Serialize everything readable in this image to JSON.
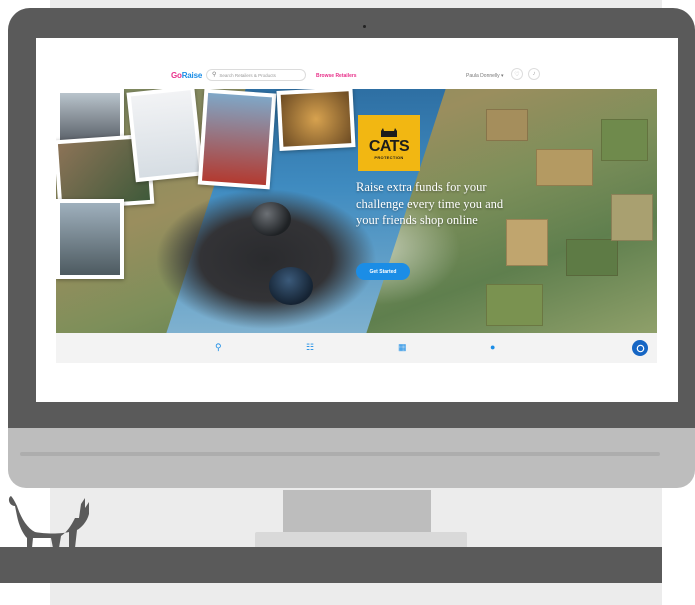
{
  "navbar": {
    "logo_part1": "Go",
    "logo_part2": "Raise",
    "search_placeholder": "Search Retailers & Products",
    "browse_link": "Browse Retailers",
    "user_name": "Paula Donnelly ▾"
  },
  "hero": {
    "charity_logo_word": "CATS",
    "charity_logo_sub": "PROTECTION",
    "headline": "Raise extra funds for your challenge every time you and your friends shop online",
    "cta_label": "Get Started"
  },
  "icon_bar": {
    "icons": [
      "search-icon",
      "cart-icon",
      "gift-icon",
      "globe-icon"
    ],
    "chat_icon": "chat-icon"
  },
  "colors": {
    "brand_pink": "#e8308a",
    "brand_blue": "#1b8de6",
    "cats_yellow": "#f2b712",
    "bezel": "#5a5a5a"
  }
}
